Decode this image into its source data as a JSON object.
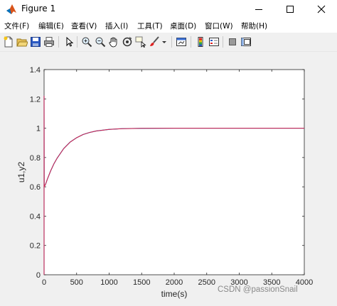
{
  "window": {
    "title": "Figure 1"
  },
  "menu": [
    "文件(F)",
    "编辑(E)",
    "查看(V)",
    "插入(I)",
    "工具(T)",
    "桌面(D)",
    "窗口(W)",
    "帮助(H)"
  ],
  "toolbar": [
    "new-file-icon",
    "open-folder-icon",
    "save-icon",
    "print-icon",
    "pointer-icon",
    "zoom-in-icon",
    "zoom-out-icon",
    "pan-hand-icon",
    "rotate-3d-icon",
    "data-cursor-icon",
    "brush-icon",
    "link-plot-icon",
    "colorbar-icon",
    "legend-icon",
    "hide-plot-tools-icon",
    "show-plot-tools-icon"
  ],
  "chart_data": {
    "type": "line",
    "xlabel": "time(s)",
    "ylabel": "u1,y2",
    "xlim": [
      0,
      4000
    ],
    "ylim": [
      0,
      1.4
    ],
    "xticks": [
      "0",
      "500",
      "1000",
      "1500",
      "2000",
      "2500",
      "3000",
      "3500",
      "4000"
    ],
    "yticks": [
      "0",
      "0.2",
      "0.4",
      "0.6",
      "0.8",
      "1",
      "1.2",
      "1.4"
    ],
    "grid": false,
    "series": [
      {
        "color": "#0072bd",
        "style": "solid",
        "x": [
          0,
          0,
          2,
          25,
          50,
          100,
          150,
          200,
          300,
          400,
          500,
          600,
          700,
          800,
          1000,
          1200,
          1500,
          2000,
          3000,
          4000
        ],
        "y": [
          0,
          1.22,
          0.6,
          0.62,
          0.652,
          0.708,
          0.756,
          0.795,
          0.86,
          0.905,
          0.935,
          0.957,
          0.971,
          0.981,
          0.992,
          0.997,
          0.999,
          1.0,
          1.0,
          1.0
        ]
      },
      {
        "color": "#e0204a",
        "style": "solid",
        "x": [
          0,
          0,
          2,
          25,
          50,
          100,
          150,
          200,
          300,
          400,
          500,
          600,
          700,
          800,
          1000,
          1200,
          1500,
          2000,
          3000,
          4000
        ],
        "y": [
          0,
          1.22,
          0.6,
          0.62,
          0.652,
          0.708,
          0.756,
          0.795,
          0.86,
          0.905,
          0.935,
          0.957,
          0.971,
          0.981,
          0.992,
          0.997,
          0.999,
          1.0,
          1.0,
          1.0
        ]
      }
    ]
  },
  "watermark": "CSDN @passionSnail"
}
